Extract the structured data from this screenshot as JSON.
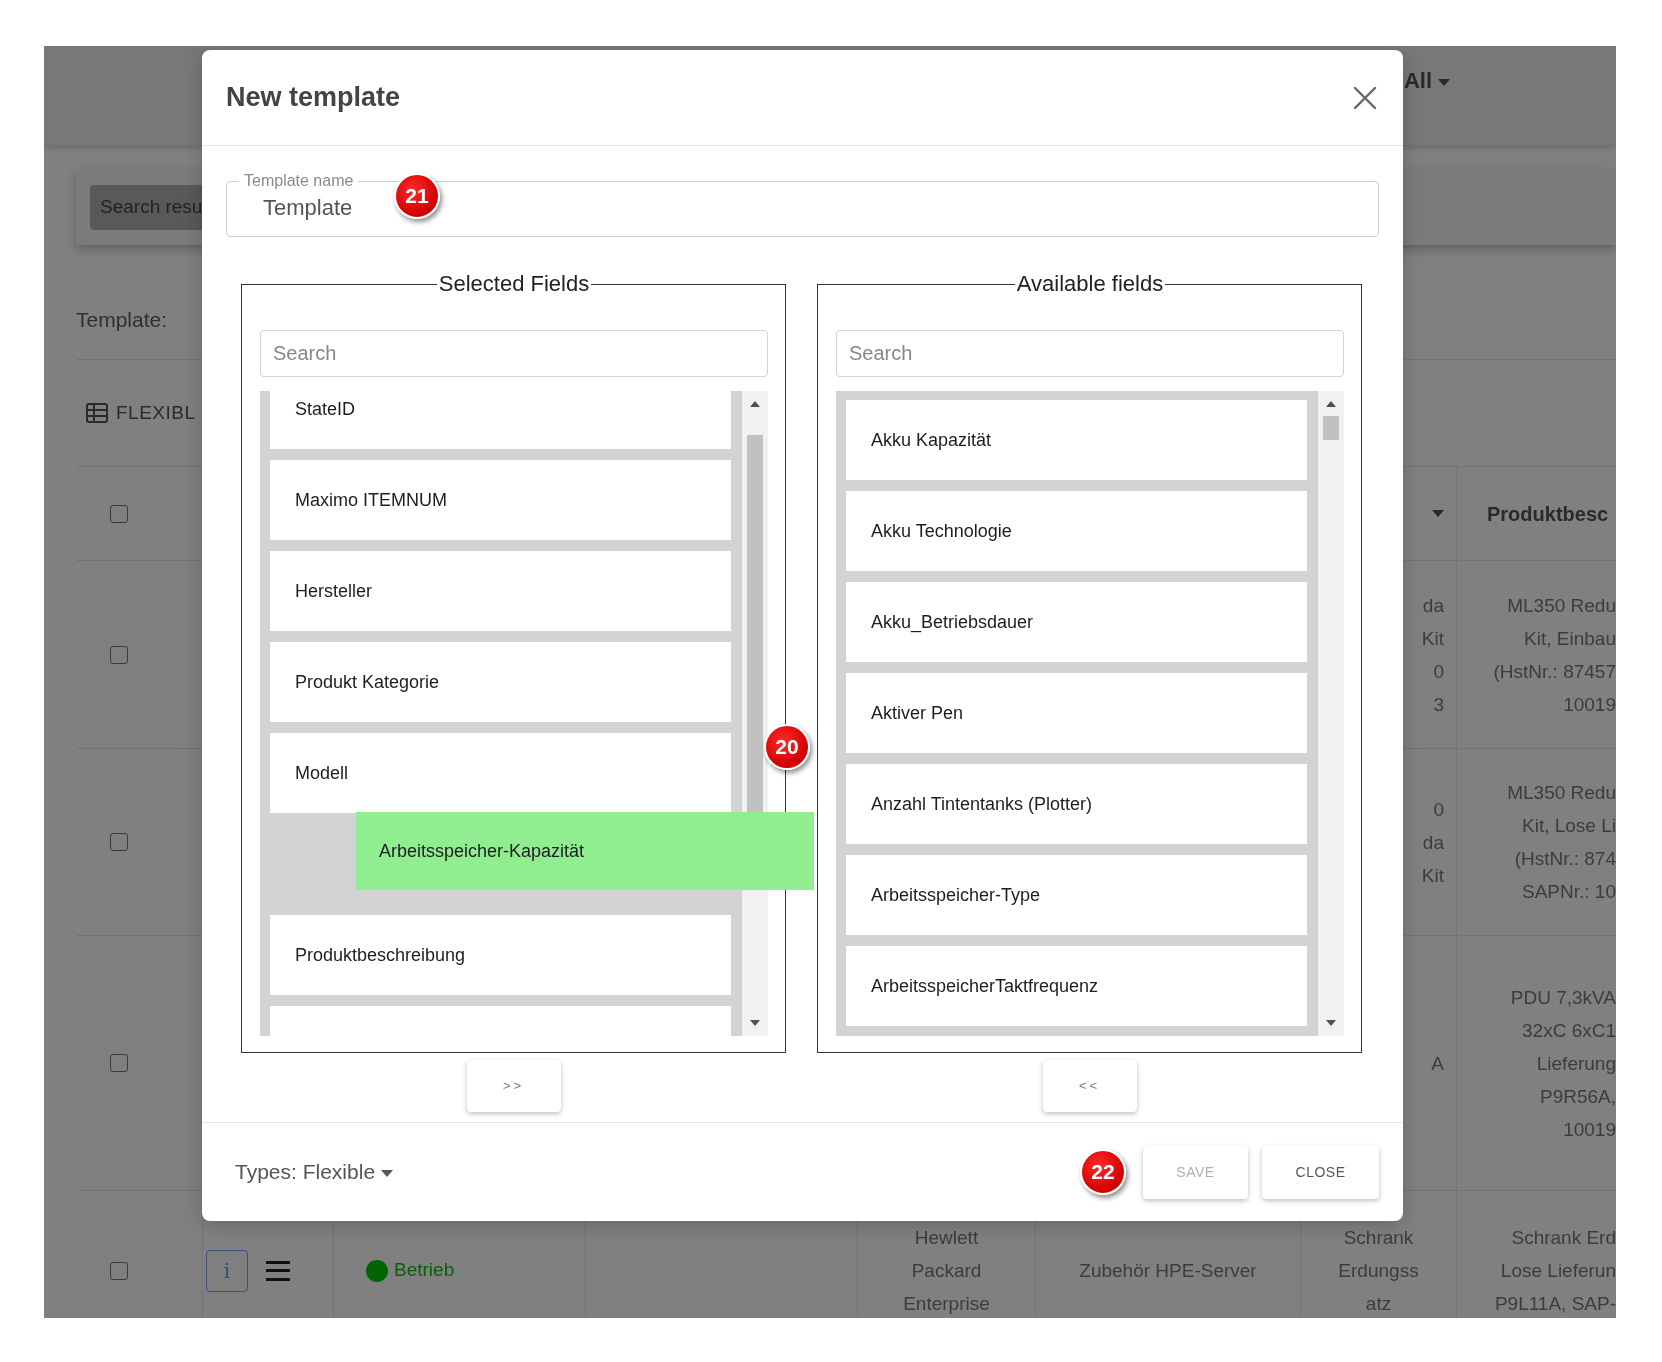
{
  "background": {
    "navbar": {
      "filter": "All"
    },
    "search_button": "Search resu",
    "template_label": "Template:",
    "section_title": "FLEXIBL",
    "table": {
      "header": {
        "checked": false,
        "column_8": "Produktbesc"
      },
      "rows": [
        {
          "checked": false,
          "column_7": [
            "da",
            "Kit",
            "0",
            "3"
          ],
          "column_8": [
            "ML350 Redu",
            "Kit, Einbau",
            "(HstNr.: 87457",
            "10019"
          ]
        },
        {
          "checked": false,
          "column_7": [
            "0",
            "da",
            "Kit"
          ],
          "column_8": [
            "ML350 Redu",
            "Kit, Lose Li",
            "(HstNr.: 874",
            "SAPNr.: 10"
          ]
        },
        {
          "checked": false,
          "column_7": [
            "A"
          ],
          "column_8": [
            "PDU 7,3kVA",
            "32xC 6xC1",
            "Lieferung",
            "P9R56A,",
            "10019"
          ]
        },
        {
          "checked": false,
          "info_button": "i",
          "status": {
            "label": "Betrieb",
            "color": "#006400"
          },
          "column_5": [
            "Hewlett",
            "Packard",
            "Enterprise"
          ],
          "column_6": [
            "Zubehör HPE-Server"
          ],
          "column_7": [
            "Schrank",
            "Erdungss",
            "atz"
          ],
          "column_8": [
            "Schrank Erd",
            "Lose Lieferun",
            "P9L11A, SAP-"
          ]
        }
      ]
    }
  },
  "modal": {
    "title": "New template",
    "template_name": {
      "label": "Template name",
      "value": "Template",
      "callout": "21"
    },
    "callout": "20",
    "selected_fields": {
      "legend": "Selected Fields",
      "search_placeholder": "Search",
      "move_button": ">>",
      "items": [
        {
          "kind": "field",
          "label": "StateID"
        },
        {
          "kind": "field",
          "label": "Maximo ITEMNUM"
        },
        {
          "kind": "field",
          "label": "Hersteller"
        },
        {
          "kind": "field",
          "label": "Produkt Kategorie"
        },
        {
          "kind": "field",
          "label": "Modell"
        },
        {
          "kind": "drop_slot"
        },
        {
          "kind": "field",
          "label": "Produktbeschreibung"
        },
        {
          "kind": "cut_off"
        }
      ],
      "dragged_item": {
        "label": "Arbeitsspeicher-Kapazität"
      }
    },
    "available_fields": {
      "legend": "Available fields",
      "search_placeholder": "Search",
      "move_button": "<<",
      "items": [
        {
          "kind": "field",
          "label": "Akku Kapazität"
        },
        {
          "kind": "field",
          "label": "Akku Technologie"
        },
        {
          "kind": "field",
          "label": "Akku_Betriebsdauer"
        },
        {
          "kind": "field",
          "label": "Aktiver Pen"
        },
        {
          "kind": "field",
          "label": "Anzahl Tintentanks (Plotter)"
        },
        {
          "kind": "field",
          "label": "Arbeitsspeicher-Type"
        },
        {
          "kind": "field",
          "label": "ArbeitsspeicherTaktfrequenz"
        }
      ]
    },
    "footer": {
      "types_dropdown": "Types: Flexible",
      "callout": "22",
      "buttons": [
        {
          "label": "SAVE",
          "disabled": true
        },
        {
          "label": "CLOSE",
          "disabled": false
        }
      ]
    }
  }
}
